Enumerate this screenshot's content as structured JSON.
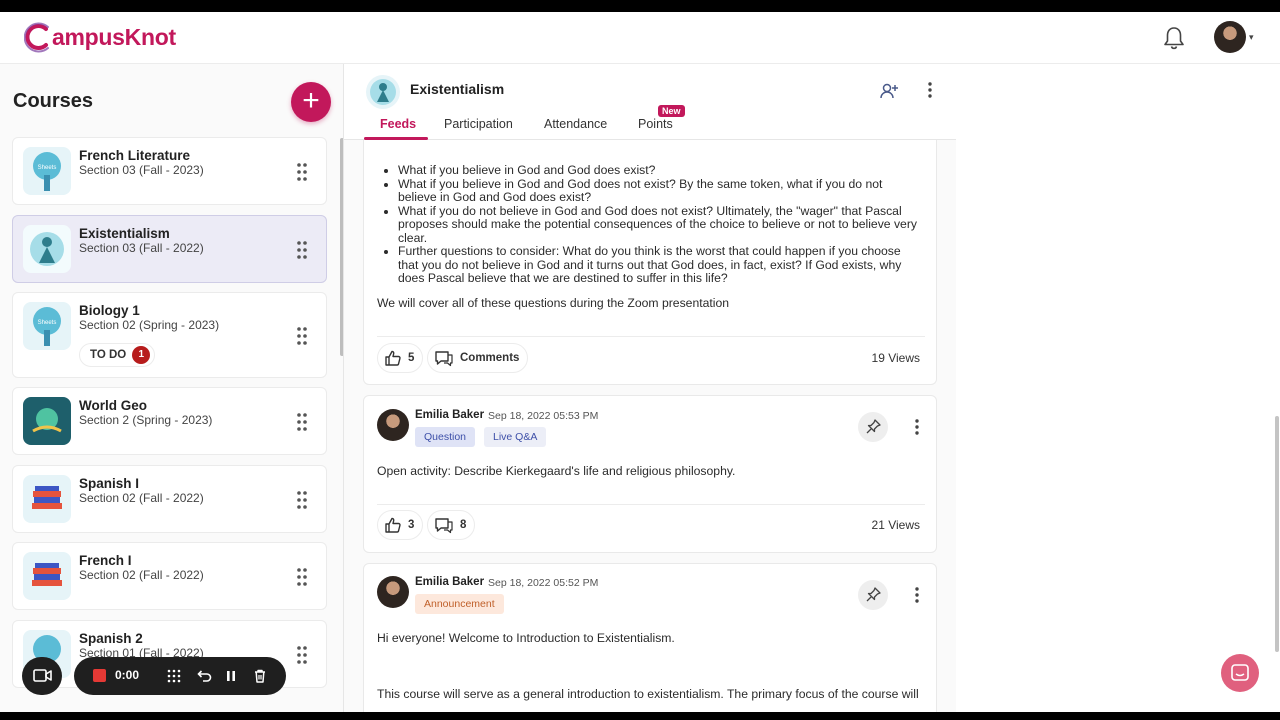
{
  "app": {
    "logo_text": "ampusKnot",
    "logo_initial": "C"
  },
  "sidebar": {
    "title": "Courses",
    "add_label": "+",
    "courses": [
      {
        "name": "French Literature",
        "section": "Section 03 (Fall - 2023)"
      },
      {
        "name": "Existentialism",
        "section": "Section 03 (Fall - 2022)"
      },
      {
        "name": "Biology 1",
        "section": "Section 02 (Spring - 2023)",
        "todo_label": "TO DO",
        "todo_count": "1"
      },
      {
        "name": "World Geo",
        "section": "Section 2 (Spring - 2023)"
      },
      {
        "name": "Spanish I",
        "section": "Section 02 (Fall - 2022)"
      },
      {
        "name": "French I",
        "section": "Section 02 (Fall - 2022)"
      },
      {
        "name": "Spanish 2",
        "section": "Section 01 (Fall - 2022)"
      }
    ]
  },
  "recorder": {
    "time": "0:00"
  },
  "class": {
    "name": "Existentialism",
    "tabs": [
      "Feeds",
      "Participation",
      "Attendance",
      "Points"
    ],
    "new_badge": "New"
  },
  "posts": [
    {
      "bullets": [
        "What if you believe in God and God does exist?",
        "What if you believe in God and God does not exist? By the same token, what if you do not believe in God and God does exist?",
        "What if you do not believe in God and God does not exist? Ultimately, the \"wager\" that Pascal proposes should make the potential consequences of the choice to believe or not to believe very clear.",
        "Further questions to consider: What do you think is the worst that could happen if you choose that you do not believe in God and it turns out that God does, in fact, exist? If God exists, why does Pascal believe that we are destined to suffer in this life?"
      ],
      "summary": "We will cover all of these questions during the Zoom presentation",
      "likes": "5",
      "comments_label": "Comments",
      "views": "19 Views"
    },
    {
      "author": "Emilia Baker",
      "timestamp": "Sep 18, 2022 05:53 PM",
      "tags": [
        "Question",
        "Live Q&A"
      ],
      "body": "Open activity: Describe Kierkegaard's life and religious philosophy.",
      "likes": "3",
      "comments": "8",
      "views": "21 Views"
    },
    {
      "author": "Emilia Baker",
      "timestamp": "Sep 18, 2022 05:52 PM",
      "tags": [
        "Announcement"
      ],
      "body": "Hi everyone! Welcome to Introduction to Existentialism.",
      "body2": "This course will serve as a general introduction to existentialism. The primary focus of the course will"
    }
  ],
  "colors": {
    "brand": "#c2185b",
    "active_course_bg": "#ecebf6",
    "record": "#e53935"
  }
}
